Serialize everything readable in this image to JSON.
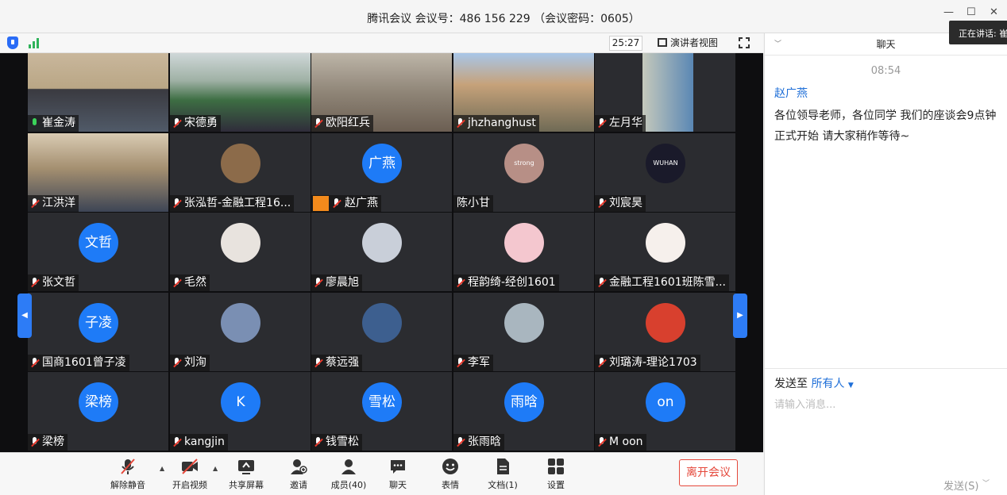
{
  "window": {
    "title": "腾讯会议 会议号：486 156 229 （会议密码：0605）",
    "speaking_label": "正在讲话: 崔"
  },
  "video_header": {
    "timer": "25:27",
    "view_label": "演讲者视图"
  },
  "participants": [
    {
      "name": "崔金涛",
      "mic": "on",
      "avatar_type": "video",
      "active": true
    },
    {
      "name": "宋德勇",
      "mic": "muted",
      "avatar_type": "video"
    },
    {
      "name": "欧阳红兵",
      "mic": "muted",
      "avatar_type": "video"
    },
    {
      "name": "jhzhanghust",
      "mic": "muted",
      "avatar_type": "video"
    },
    {
      "name": "左月华",
      "mic": "muted",
      "avatar_type": "video"
    },
    {
      "name": "江洪洋",
      "mic": "muted",
      "avatar_type": "video"
    },
    {
      "name": "张泓哲-金融工程16...",
      "mic": "muted",
      "avatar_type": "image",
      "avatar_color": "#8c6b4a"
    },
    {
      "name": "赵广燕",
      "mic": "muted",
      "avatar_type": "text",
      "avatar_text": "广燕",
      "host_badge": true
    },
    {
      "name": "陈小甘",
      "mic": "none",
      "avatar_type": "image",
      "avatar_color": "#b78f86",
      "avatar_text": "strong"
    },
    {
      "name": "刘宸昊",
      "mic": "muted",
      "avatar_type": "image",
      "avatar_color": "#1a1a2a",
      "avatar_text": "WUHAN"
    },
    {
      "name": "张文哲",
      "mic": "muted",
      "avatar_type": "text",
      "avatar_text": "文哲"
    },
    {
      "name": "毛然",
      "mic": "muted",
      "avatar_type": "image",
      "avatar_color": "#e8e3de"
    },
    {
      "name": "廖晨旭",
      "mic": "muted",
      "avatar_type": "image",
      "avatar_color": "#c9cfd9"
    },
    {
      "name": "程韵绮-经创1601",
      "mic": "muted",
      "avatar_type": "image",
      "avatar_color": "#f4c7cf"
    },
    {
      "name": "金融工程1601班陈雪...",
      "mic": "muted",
      "avatar_type": "image",
      "avatar_color": "#f6f0ec"
    },
    {
      "name": "国商1601曾子凌",
      "mic": "muted",
      "avatar_type": "text",
      "avatar_text": "子凌"
    },
    {
      "name": "刘洵",
      "mic": "muted",
      "avatar_type": "image",
      "avatar_color": "#7a8fb3"
    },
    {
      "name": "蔡远强",
      "mic": "muted",
      "avatar_type": "image",
      "avatar_color": "#3d5f8f"
    },
    {
      "name": "李军",
      "mic": "muted",
      "avatar_type": "image",
      "avatar_color": "#a9b6bf"
    },
    {
      "name": "刘璐涛-理论1703",
      "mic": "muted",
      "avatar_type": "image",
      "avatar_color": "#d8402e"
    },
    {
      "name": "梁榜",
      "mic": "muted",
      "avatar_type": "text",
      "avatar_text": "梁榜"
    },
    {
      "name": "kangjin",
      "mic": "muted",
      "avatar_type": "text",
      "avatar_text": "K"
    },
    {
      "name": "钱雪松",
      "mic": "muted",
      "avatar_type": "text",
      "avatar_text": "雪松"
    },
    {
      "name": "张雨晗",
      "mic": "muted",
      "avatar_type": "text",
      "avatar_text": "雨晗"
    },
    {
      "name": "M oon",
      "mic": "muted",
      "avatar_type": "text",
      "avatar_text": "on"
    }
  ],
  "toolbar": {
    "unmute": "解除静音",
    "start_video": "开启视频",
    "share_screen": "共享屏幕",
    "invite": "邀请",
    "members": "成员(40)",
    "chat": "聊天",
    "reactions": "表情",
    "docs": "文档(1)",
    "settings": "设置",
    "leave": "离开会议"
  },
  "chat": {
    "header": "聊天",
    "time": "08:54",
    "sender": "赵广燕",
    "message": "各位领导老师，各位同学  我们的座谈会9点钟正式开始   请大家稍作等待~",
    "send_to_label": "发送至",
    "send_to_target": "所有人",
    "input_placeholder": "请输入消息...",
    "send_button": "发送(S)"
  },
  "colors": {
    "accent": "#1e7bf7",
    "danger": "#e5483b",
    "active_speaker": "#39c34a"
  }
}
